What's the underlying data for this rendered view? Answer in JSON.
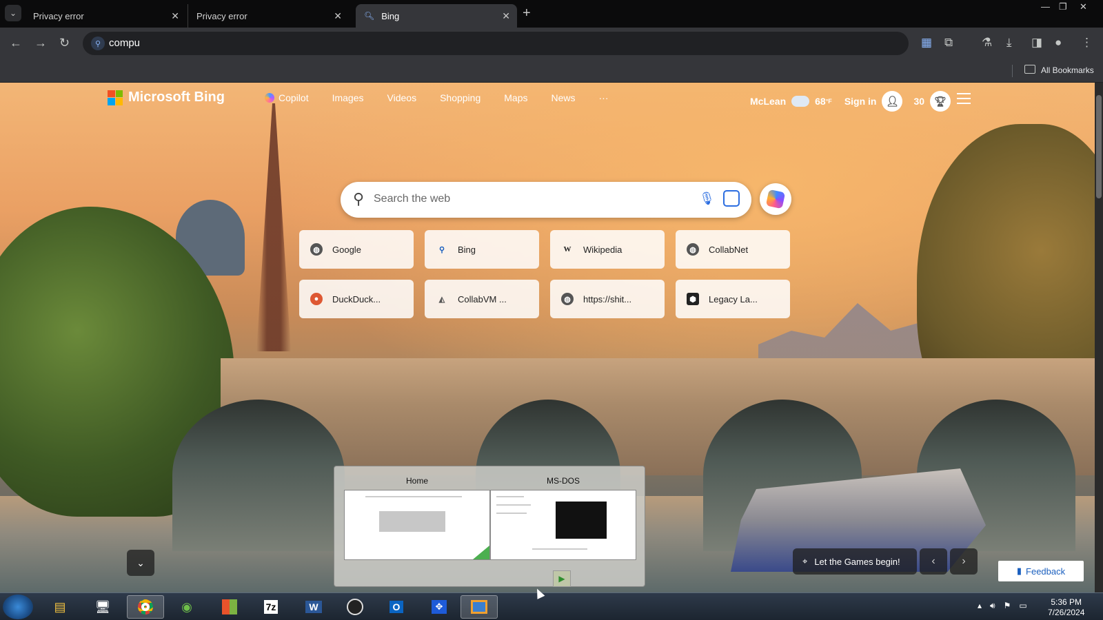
{
  "browser": {
    "tabs": [
      {
        "label": "Privacy error"
      },
      {
        "label": "Privacy error"
      },
      {
        "label": "Bing"
      }
    ],
    "address": "compu",
    "bookmarks_label": "All Bookmarks"
  },
  "bing": {
    "logo_text": "Microsoft Bing",
    "nav": [
      "Copilot",
      "Images",
      "Videos",
      "Shopping",
      "Maps",
      "News",
      "···"
    ],
    "location": "McLean",
    "temperature": "68",
    "temp_unit": "°F",
    "sign_in": "Sign in",
    "rewards": "30",
    "search_placeholder": "Search the web",
    "quick_links": [
      {
        "label": "Google",
        "icon": "globe-icon"
      },
      {
        "label": "Bing",
        "icon": "search-icon"
      },
      {
        "label": "Wikipedia",
        "icon": "wikipedia-icon"
      },
      {
        "label": "CollabNet",
        "icon": "globe-icon"
      },
      {
        "label": "DuckDuck...",
        "icon": "duckduckgo-icon"
      },
      {
        "label": "CollabVM ...",
        "icon": "collabvm-icon"
      },
      {
        "label": "https://shit...",
        "icon": "globe-icon"
      },
      {
        "label": "Legacy La...",
        "icon": "shield-icon"
      }
    ],
    "image_caption": "Let the Games begin!",
    "feedback": "Feedback"
  },
  "taskbar_preview": {
    "windows": [
      {
        "title": "Home"
      },
      {
        "title": "MS-DOS"
      }
    ]
  },
  "taskbar": {
    "time": "5:36 PM",
    "date": "7/26/2024"
  }
}
